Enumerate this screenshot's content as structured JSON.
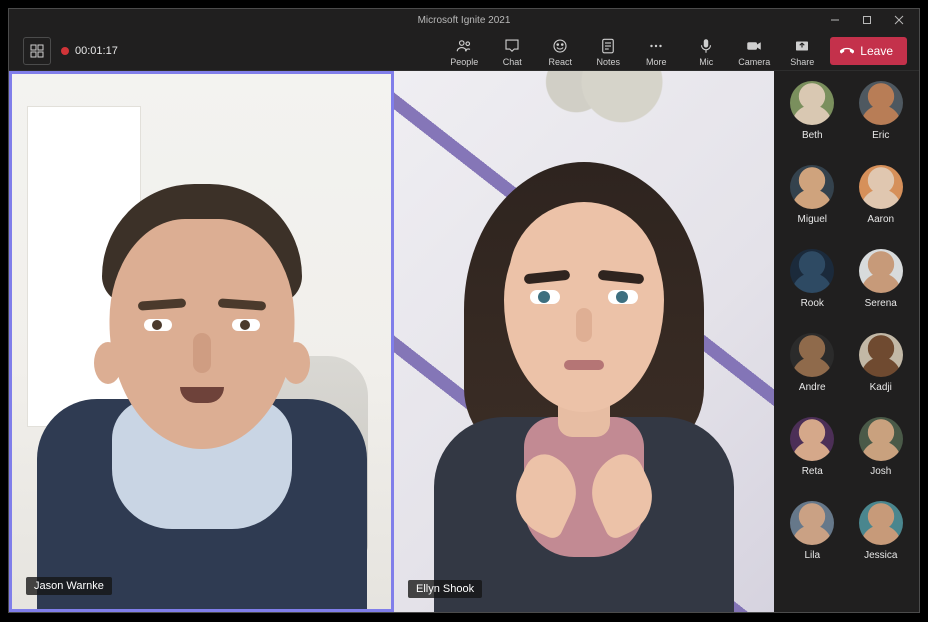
{
  "window": {
    "title": "Microsoft Ignite 2021"
  },
  "toolbar": {
    "timer": "00:01:17",
    "people": "People",
    "chat": "Chat",
    "react": "React",
    "notes": "Notes",
    "more": "More",
    "mic": "Mic",
    "camera": "Camera",
    "share": "Share",
    "leave": "Leave"
  },
  "tiles": {
    "a_name": "Jason Warnke",
    "b_name": "Ellyn Shook"
  },
  "roster": [
    {
      "name": "Beth",
      "c1": "#7a8f5d",
      "c2": "#d9c8b2"
    },
    {
      "name": "Eric",
      "c1": "#4e5860",
      "c2": "#b87d56"
    },
    {
      "name": "Miguel",
      "c1": "#34424d",
      "c2": "#cfa37d"
    },
    {
      "name": "Aaron",
      "c1": "#d6905a",
      "c2": "#e0c7b0"
    },
    {
      "name": "Rook",
      "c1": "#1b2a3b",
      "c2": "#2e4a63"
    },
    {
      "name": "Serena",
      "c1": "#d8dbdc",
      "c2": "#c79a79"
    },
    {
      "name": "Andre",
      "c1": "#2b2b2b",
      "c2": "#8f6a4b"
    },
    {
      "name": "Kadji",
      "c1": "#c2b8a6",
      "c2": "#6f4a30"
    },
    {
      "name": "Reta",
      "c1": "#4c2f57",
      "c2": "#d5a88a"
    },
    {
      "name": "Josh",
      "c1": "#4a5a48",
      "c2": "#c9a17e"
    },
    {
      "name": "Lila",
      "c1": "#66788a",
      "c2": "#caa184"
    },
    {
      "name": "Jessica",
      "c1": "#4a868e",
      "c2": "#c79a79"
    }
  ],
  "colors": {
    "accent": "#807eea",
    "danger": "#c4314b",
    "record": "#d13438"
  }
}
